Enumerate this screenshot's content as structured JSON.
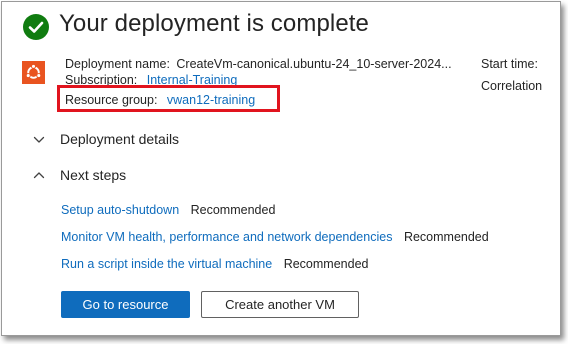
{
  "header": {
    "title": "Your deployment is complete",
    "status_icon": "success-check-icon",
    "status_color": "#107c10"
  },
  "deployment": {
    "icon": "ubuntu-icon",
    "icon_color": "#e95420",
    "name_label": "Deployment name:",
    "name_value": "CreateVm-canonical.ubuntu-24_10-server-2024...",
    "subscription_label": "Subscription:",
    "subscription_value": "Internal-Training",
    "resource_group_label": "Resource group:",
    "resource_group_value": "vwan12-training",
    "start_time_label": "Start time:",
    "correlation_label": "Correlation"
  },
  "sections": {
    "details": {
      "label": "Deployment details",
      "expanded": false
    },
    "next_steps": {
      "label": "Next steps",
      "expanded": true
    }
  },
  "next_steps": [
    {
      "link": "Setup auto-shutdown",
      "tag": "Recommended"
    },
    {
      "link": "Monitor VM health, performance and network dependencies",
      "tag": "Recommended"
    },
    {
      "link": "Run a script inside the virtual machine",
      "tag": "Recommended"
    }
  ],
  "actions": {
    "primary": "Go to resource",
    "secondary": "Create another VM"
  },
  "colors": {
    "accent": "#0f6cbd",
    "highlight_border": "#e1141e"
  }
}
